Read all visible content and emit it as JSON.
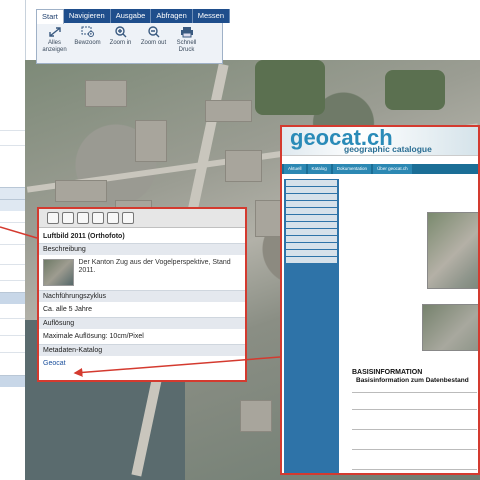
{
  "ribbon": {
    "tabs": [
      "Start",
      "Navigieren",
      "Ausgabe",
      "Abfragen",
      "Messen"
    ],
    "tools": [
      {
        "label": "Alles anzeigen",
        "icon": "expand-icon"
      },
      {
        "label": "Bewzoom",
        "icon": "zoom-box-icon"
      },
      {
        "label": "Zoom in",
        "icon": "zoom-in-icon"
      },
      {
        "label": "Zoom out",
        "icon": "zoom-out-icon"
      },
      {
        "label": "Schnell Druck",
        "icon": "printer-icon"
      }
    ]
  },
  "popup": {
    "title": "Luftbild 2011 (Orthofoto)",
    "sections": {
      "beschreibung": "Beschreibung",
      "beschreibung_text": "Der Kanton Zug aus der Vogelperspektive, Stand 2011.",
      "zyklus": "Nachführungszyklus",
      "zyklus_text": "Ca. alle 5 Jahre",
      "aufloesung": "Auflösung",
      "aufloesung_text": "Maximale Auflösung: 10cm/Pixel",
      "katalog": "Metadaten-Katalog",
      "katalog_link": "Geocat"
    }
  },
  "geocat": {
    "logo": "geocat.ch",
    "subtitle": "geographic catalogue",
    "nav": [
      "Aktuell",
      "Katalog",
      "Dokumentation",
      "Über geocat.ch"
    ],
    "section_title": "BASISINFORMATION",
    "section_sub": "Basisinformation zum Datenbestand"
  },
  "colors": {
    "accent": "#d43a2f",
    "ribbon_blue": "#1f4e8c",
    "geocat_blue": "#2a8bb8"
  }
}
